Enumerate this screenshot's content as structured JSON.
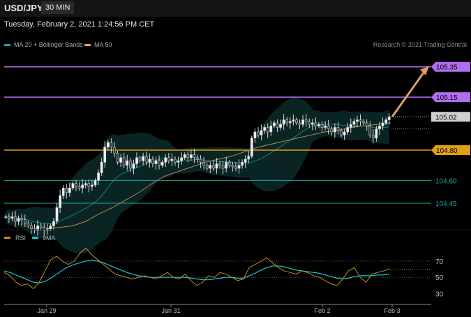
{
  "header": {
    "symbol": "USD/JPY",
    "interval": "30 MIN"
  },
  "timestamp": "Tuesday, February 2, 2021 1:24:56 PM CET",
  "legend": [
    {
      "label": "MA 20 + Bollinger Bands",
      "color": "#18a0a0"
    },
    {
      "label": "MA 50",
      "color": "#e0a050"
    }
  ],
  "credit": "Research © 2021 Trading Central",
  "chart_data": [
    {
      "type": "candlestick",
      "price_range": [
        104.27,
        105.45
      ],
      "x_ticks": [
        "Jan 29",
        "Jan 31",
        "Feb 2",
        "Feb 3"
      ],
      "levels": [
        {
          "value": 105.35,
          "label": "105.35",
          "color": "#b26cf0",
          "kind": "resistance"
        },
        {
          "value": 105.15,
          "label": "105.15",
          "color": "#b26cf0",
          "kind": "resistance"
        },
        {
          "value": 105.02,
          "label": "105.02",
          "color": "#cfcfcf",
          "kind": "current"
        },
        {
          "value": 104.8,
          "label": "104.80",
          "color": "#e0a010",
          "kind": "pivot"
        },
        {
          "value": 104.6,
          "label": "104.60",
          "color": "#1aa3a3",
          "kind": "support"
        },
        {
          "value": 104.45,
          "label": "104.45",
          "color": "#1aa3a3",
          "kind": "support"
        }
      ],
      "target_arrow": {
        "from": 105.02,
        "to": 105.35
      },
      "close_path": [
        104.36,
        104.35,
        104.36,
        104.33,
        104.35,
        104.34,
        104.32,
        104.3,
        104.28,
        104.27,
        104.3,
        104.29,
        104.27,
        104.28,
        104.3,
        104.33,
        104.42,
        104.5,
        104.55,
        104.52,
        104.55,
        104.58,
        104.56,
        104.55,
        104.57,
        104.58,
        104.56,
        104.57,
        104.6,
        104.65,
        104.72,
        104.82,
        104.85,
        104.82,
        104.78,
        104.72,
        104.75,
        104.7,
        104.73,
        104.68,
        104.71,
        104.75,
        104.73,
        104.76,
        104.72,
        104.74,
        104.71,
        104.73,
        104.7,
        104.72,
        104.75,
        104.73,
        104.74,
        104.72,
        104.73,
        104.75,
        104.77,
        104.75,
        104.77,
        104.75,
        104.74,
        104.72,
        104.7,
        104.68,
        104.7,
        104.68,
        104.71,
        104.7,
        104.68,
        104.72,
        104.7,
        104.69,
        104.68,
        104.7,
        104.72,
        104.74,
        104.76,
        104.88,
        104.92,
        104.9,
        104.93,
        104.95,
        104.92,
        104.96,
        104.98,
        104.95,
        104.97,
        105.0,
        104.98,
        104.99,
        105.0,
        104.98,
        104.97,
        105.0,
        104.99,
        104.97,
        104.98,
        104.96,
        104.97,
        104.95,
        104.96,
        104.94,
        104.92,
        104.95,
        104.93,
        104.9,
        104.92,
        104.95,
        104.97,
        104.99,
        105.0,
        104.99,
        104.98,
        104.96,
        104.9,
        104.88,
        104.94,
        104.96,
        104.98,
        105.0,
        105.02
      ],
      "ma50_path": [
        104.28,
        104.29,
        104.3,
        104.33,
        104.38,
        104.42,
        104.47,
        104.52,
        104.58,
        104.63,
        104.66,
        104.69,
        104.72,
        104.74,
        104.76,
        104.79,
        104.82,
        104.84,
        104.86,
        104.88,
        104.9,
        104.92,
        104.93,
        104.95,
        104.96,
        104.97,
        104.98
      ],
      "rsi_panel": {
        "y_range": [
          20,
          95
        ],
        "ticks": [
          70,
          50,
          30
        ],
        "series": [
          {
            "name": "RSI",
            "color": "#c98a1f"
          },
          {
            "name": "9MA",
            "color": "#18c8d8"
          }
        ],
        "rsi": [
          56,
          52,
          44,
          40,
          42,
          36,
          44,
          58,
          72,
          76,
          70,
          66,
          70,
          80,
          86,
          78,
          72,
          66,
          60,
          54,
          52,
          50,
          48,
          50,
          52,
          50,
          48,
          52,
          56,
          50,
          48,
          54,
          46,
          40,
          44,
          52,
          50,
          56,
          54,
          50,
          46,
          48,
          62,
          66,
          70,
          74,
          68,
          62,
          58,
          56,
          54,
          58,
          56,
          52,
          50,
          46,
          42,
          40,
          48,
          58,
          62,
          50,
          44,
          54,
          56,
          58,
          60
        ],
        "ma9": [
          58,
          56,
          53,
          50,
          47,
          44,
          43,
          45,
          49,
          54,
          59,
          63,
          66,
          68,
          70,
          71,
          70,
          68,
          65,
          62,
          59,
          56,
          54,
          52,
          51,
          50,
          50,
          50,
          50,
          50,
          50,
          50,
          49,
          48,
          47,
          47,
          48,
          49,
          50,
          50,
          49,
          49,
          52,
          55,
          59,
          62,
          64,
          64,
          63,
          61,
          59,
          58,
          57,
          56,
          55,
          53,
          51,
          49,
          48,
          49,
          51,
          52,
          52,
          52,
          53,
          53,
          54
        ]
      }
    }
  ]
}
